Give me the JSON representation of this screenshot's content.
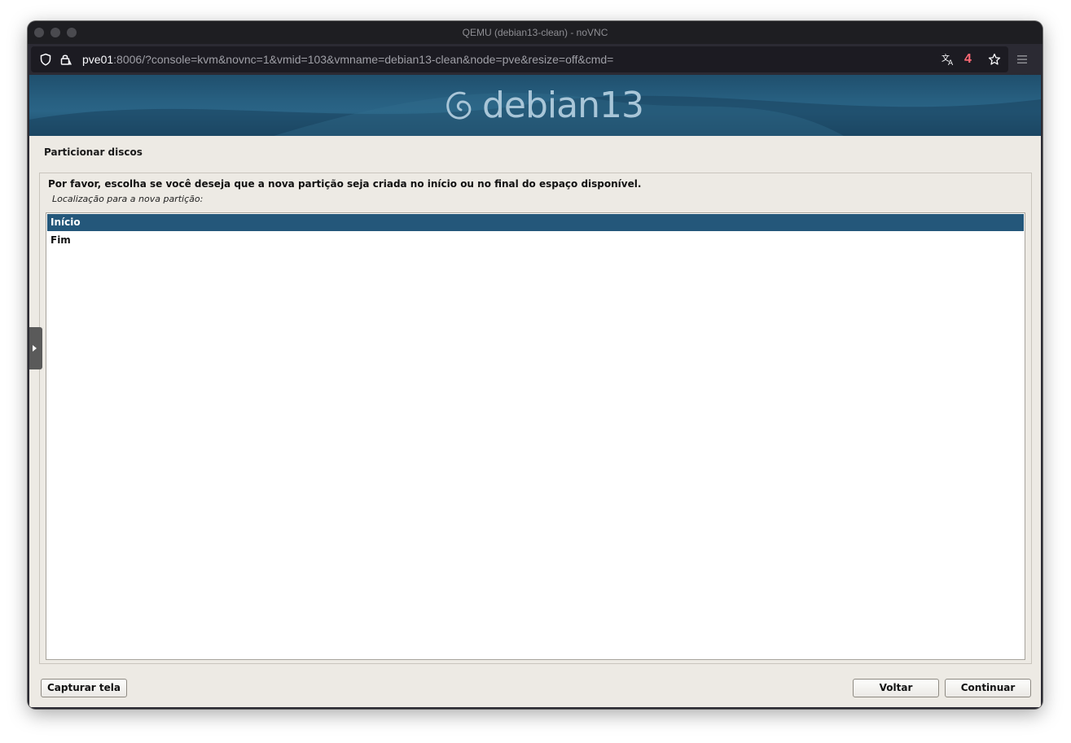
{
  "window": {
    "title": "QEMU (debian13-clean) - noVNC"
  },
  "urlbar": {
    "host": "pve01",
    "rest": ":8006/?console=kvm&novnc=1&vmid=103&vmname=debian13-clean&node=pve&resize=off&cmd=",
    "translate_badge": "4"
  },
  "banner": {
    "logo_text": "debian13"
  },
  "installer": {
    "section_title": "Particionar discos",
    "question": "Por favor, escolha se você deseja que a nova partição seja criada no início ou no final do espaço disponível.",
    "hint": "Localização para a nova partição:",
    "options": [
      {
        "label": "Início",
        "selected": true
      },
      {
        "label": "Fim",
        "selected": false
      }
    ]
  },
  "buttons": {
    "screenshot": "Capturar tela",
    "back": "Voltar",
    "continue": "Continuar"
  },
  "colors": {
    "selection": "#24577a",
    "background": "#edeae4",
    "badge": "#ff6a75"
  }
}
